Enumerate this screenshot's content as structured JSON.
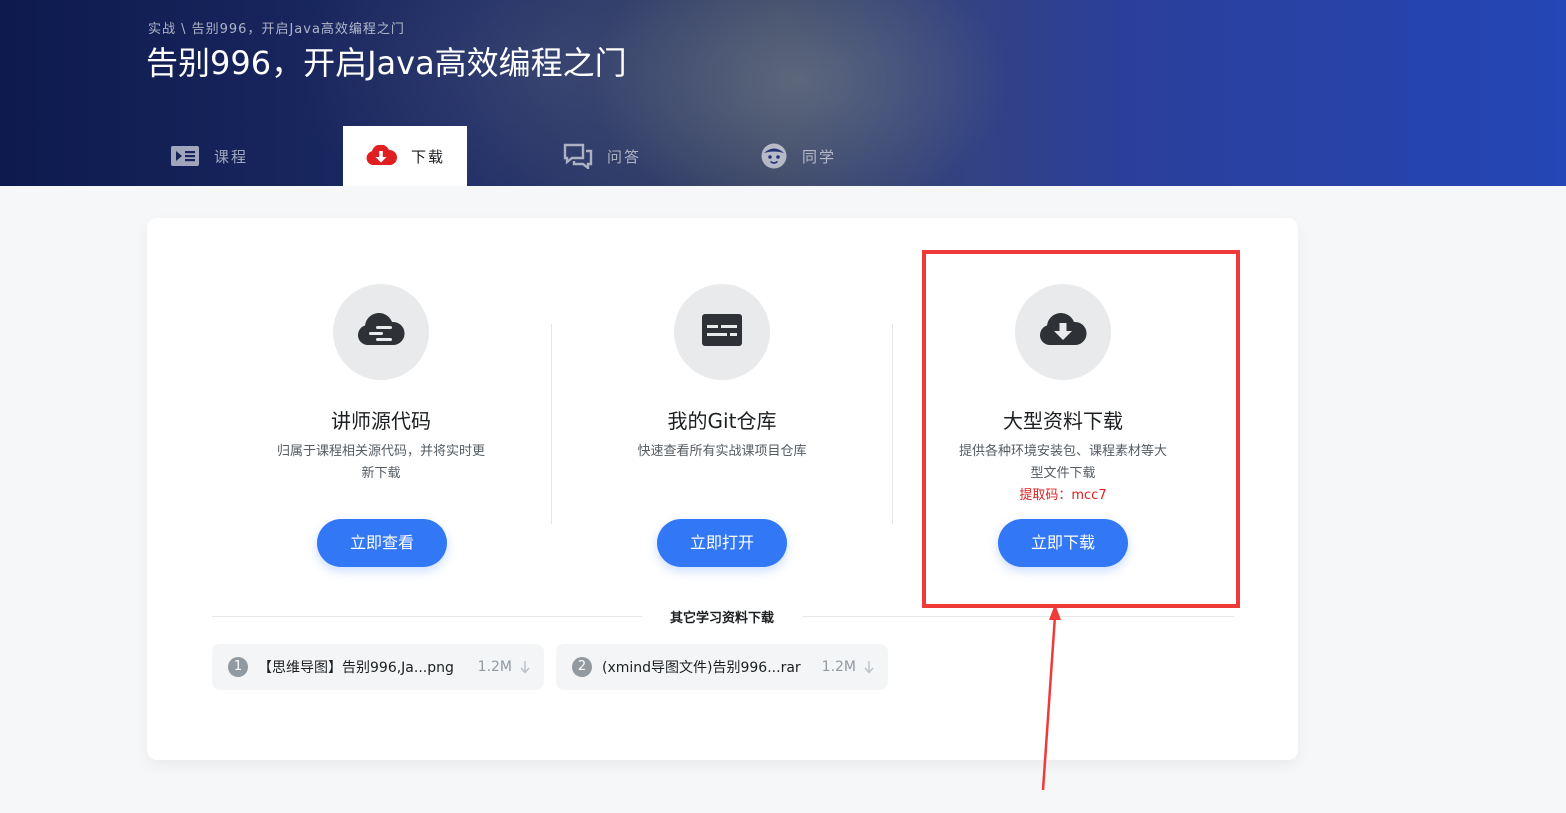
{
  "header": {
    "breadcrumb": "实战 \\ 告别996，开启Java高效编程之门",
    "title": "告别996，开启Java高效编程之门"
  },
  "tabs": [
    {
      "label": "课程",
      "icon": "course-list-icon"
    },
    {
      "label": "下载",
      "icon": "cloud-download-icon",
      "active": true
    },
    {
      "label": "问答",
      "icon": "chat-bubbles-icon"
    },
    {
      "label": "同学",
      "icon": "smiley-face-icon"
    }
  ],
  "resources": [
    {
      "title": "讲师源代码",
      "desc": "归属于课程相关源代码，并将实时更新下载",
      "button": "立即查看",
      "icon": "cloud-code-icon"
    },
    {
      "title": "我的Git仓库",
      "desc": "快速查看所有实战课项目仓库",
      "button": "立即打开",
      "icon": "repository-icon"
    },
    {
      "title": "大型资料下载",
      "desc": "提供各种环境安装包、课程素材等大型文件下载",
      "code": "提取码：mcc7",
      "button": "立即下载",
      "icon": "cloud-download-icon"
    }
  ],
  "other": {
    "title": "其它学习资料下载",
    "files": [
      {
        "index": "1",
        "name": "【思维导图】告别996,Ja...png",
        "size": "1.2M"
      },
      {
        "index": "2",
        "name": "(xmind导图文件)告别996...rar",
        "size": "1.2M"
      }
    ]
  },
  "colors": {
    "primary_button": "#3177f6",
    "annotation": "#f03a3a",
    "code_text": "#e02020"
  }
}
